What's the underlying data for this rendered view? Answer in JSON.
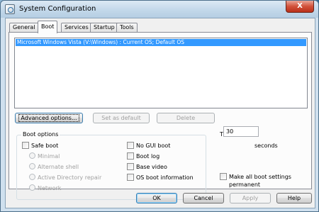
{
  "window": {
    "title": "System Configuration",
    "close_glyph": "X"
  },
  "tabs": [
    {
      "label": "General"
    },
    {
      "label": "Boot"
    },
    {
      "label": "Services"
    },
    {
      "label": "Startup"
    },
    {
      "label": "Tools"
    }
  ],
  "active_tab": "Boot",
  "os_list": {
    "items": [
      {
        "label": "Microsoft Windows Vista (V:\\Windows) : Current OS; Default OS",
        "selected": true
      }
    ]
  },
  "os_buttons": {
    "advanced": "Advanced options...",
    "set_default": "Set as default",
    "delete": "Delete"
  },
  "boot_options": {
    "title": "Boot options",
    "safe_boot": {
      "label": "Safe boot",
      "checked": false
    },
    "safe_modes": [
      {
        "label": "Minimal"
      },
      {
        "label": "Alternate shell"
      },
      {
        "label": "Active Directory repair"
      },
      {
        "label": "Network"
      }
    ],
    "right_options": [
      {
        "label": "No GUI boot",
        "checked": false
      },
      {
        "label": "Boot log",
        "checked": false
      },
      {
        "label": "Base video",
        "checked": false
      },
      {
        "label": "OS boot information",
        "checked": false
      }
    ]
  },
  "timeout": {
    "label": "Timeout:",
    "value": "30",
    "unit": "seconds"
  },
  "make_permanent": {
    "label_line1": "Make all boot settings",
    "label_line2": "permanent",
    "checked": false
  },
  "footer_buttons": {
    "ok": "OK",
    "cancel": "Cancel",
    "apply": "Apply",
    "help": "Help"
  }
}
